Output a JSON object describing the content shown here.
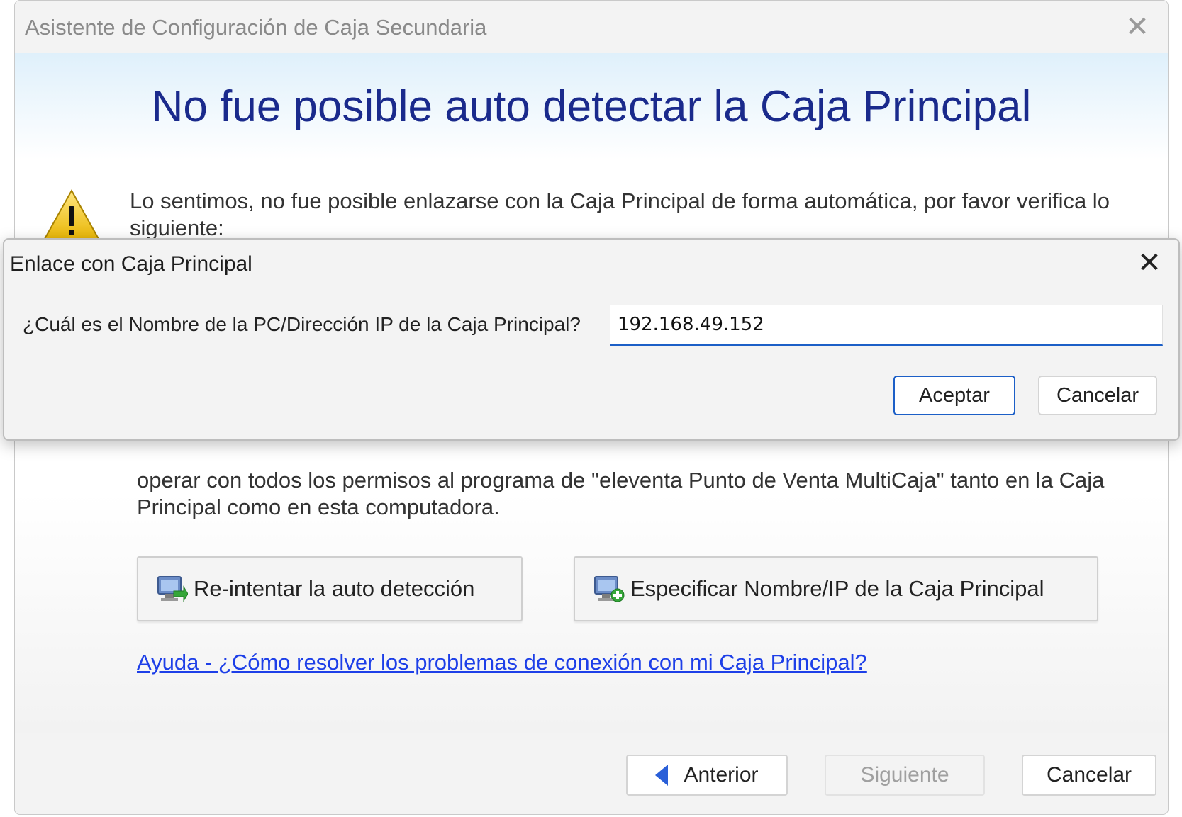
{
  "wizard": {
    "title": "Asistente de Configuración de Caja Secundaria",
    "close_symbol": "✕",
    "headline": "No fue posible auto detectar la Caja Principal",
    "warning_icon": "warning-triangle-icon",
    "intro_text": "Lo sentimos, no fue posible enlazarse con la Caja Principal de forma automática, por favor verifica lo siguiente:",
    "body_text": "operar con todos los permisos al programa de \"eleventa Punto de Venta MultiCaja\" tanto en la Caja Principal como en esta computadora.",
    "buttons": {
      "retry_label": "Re-intentar la auto detección",
      "specify_label": "Especificar Nombre/IP de la Caja Principal"
    },
    "help_link": "Ayuda - ¿Cómo resolver los problemas de conexión con mi Caja Principal?",
    "footer": {
      "back_label": "Anterior",
      "next_label": "Siguiente",
      "cancel_label": "Cancelar"
    }
  },
  "dialog": {
    "title": "Enlace con Caja Principal",
    "close_symbol": "✕",
    "prompt": "¿Cuál es el Nombre de la PC/Dirección IP de la Caja Principal?",
    "input_value": "192.168.49.152",
    "ok_label": "Aceptar",
    "cancel_label": "Cancelar"
  },
  "colors": {
    "headline": "#1a2a8c",
    "link": "#1d3fe8",
    "accent": "#1c5fc7"
  }
}
